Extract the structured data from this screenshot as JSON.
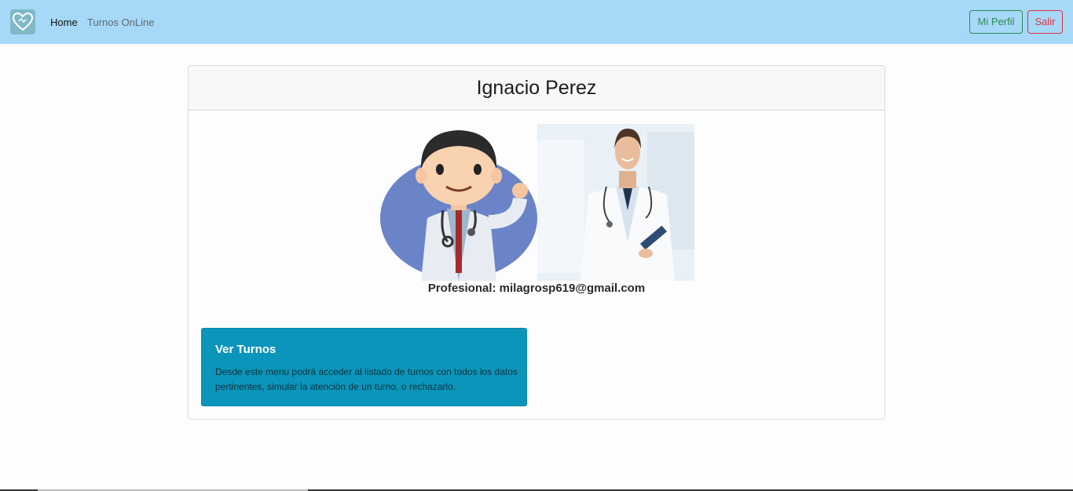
{
  "navbar": {
    "logo_icon": "heart-logo-icon",
    "links": [
      {
        "label": "Home"
      },
      {
        "label": "Turnos OnLine"
      }
    ],
    "profile_button": "Mi Perfil",
    "logout_button": "Salir",
    "background": "#a6d8f7"
  },
  "card": {
    "title": "Ignacio Perez",
    "image_icon": "doctor-illustration",
    "profesional_label": "Profesional: milagrosp619@gmail.com"
  },
  "tile": {
    "title": "Ver Turnos",
    "description": "Desde este menu podrá acceder al listado de turnos con todos los datos pertinentes, simular la atención de un turno, o rechazarlo.",
    "background": "#0b95bb"
  }
}
